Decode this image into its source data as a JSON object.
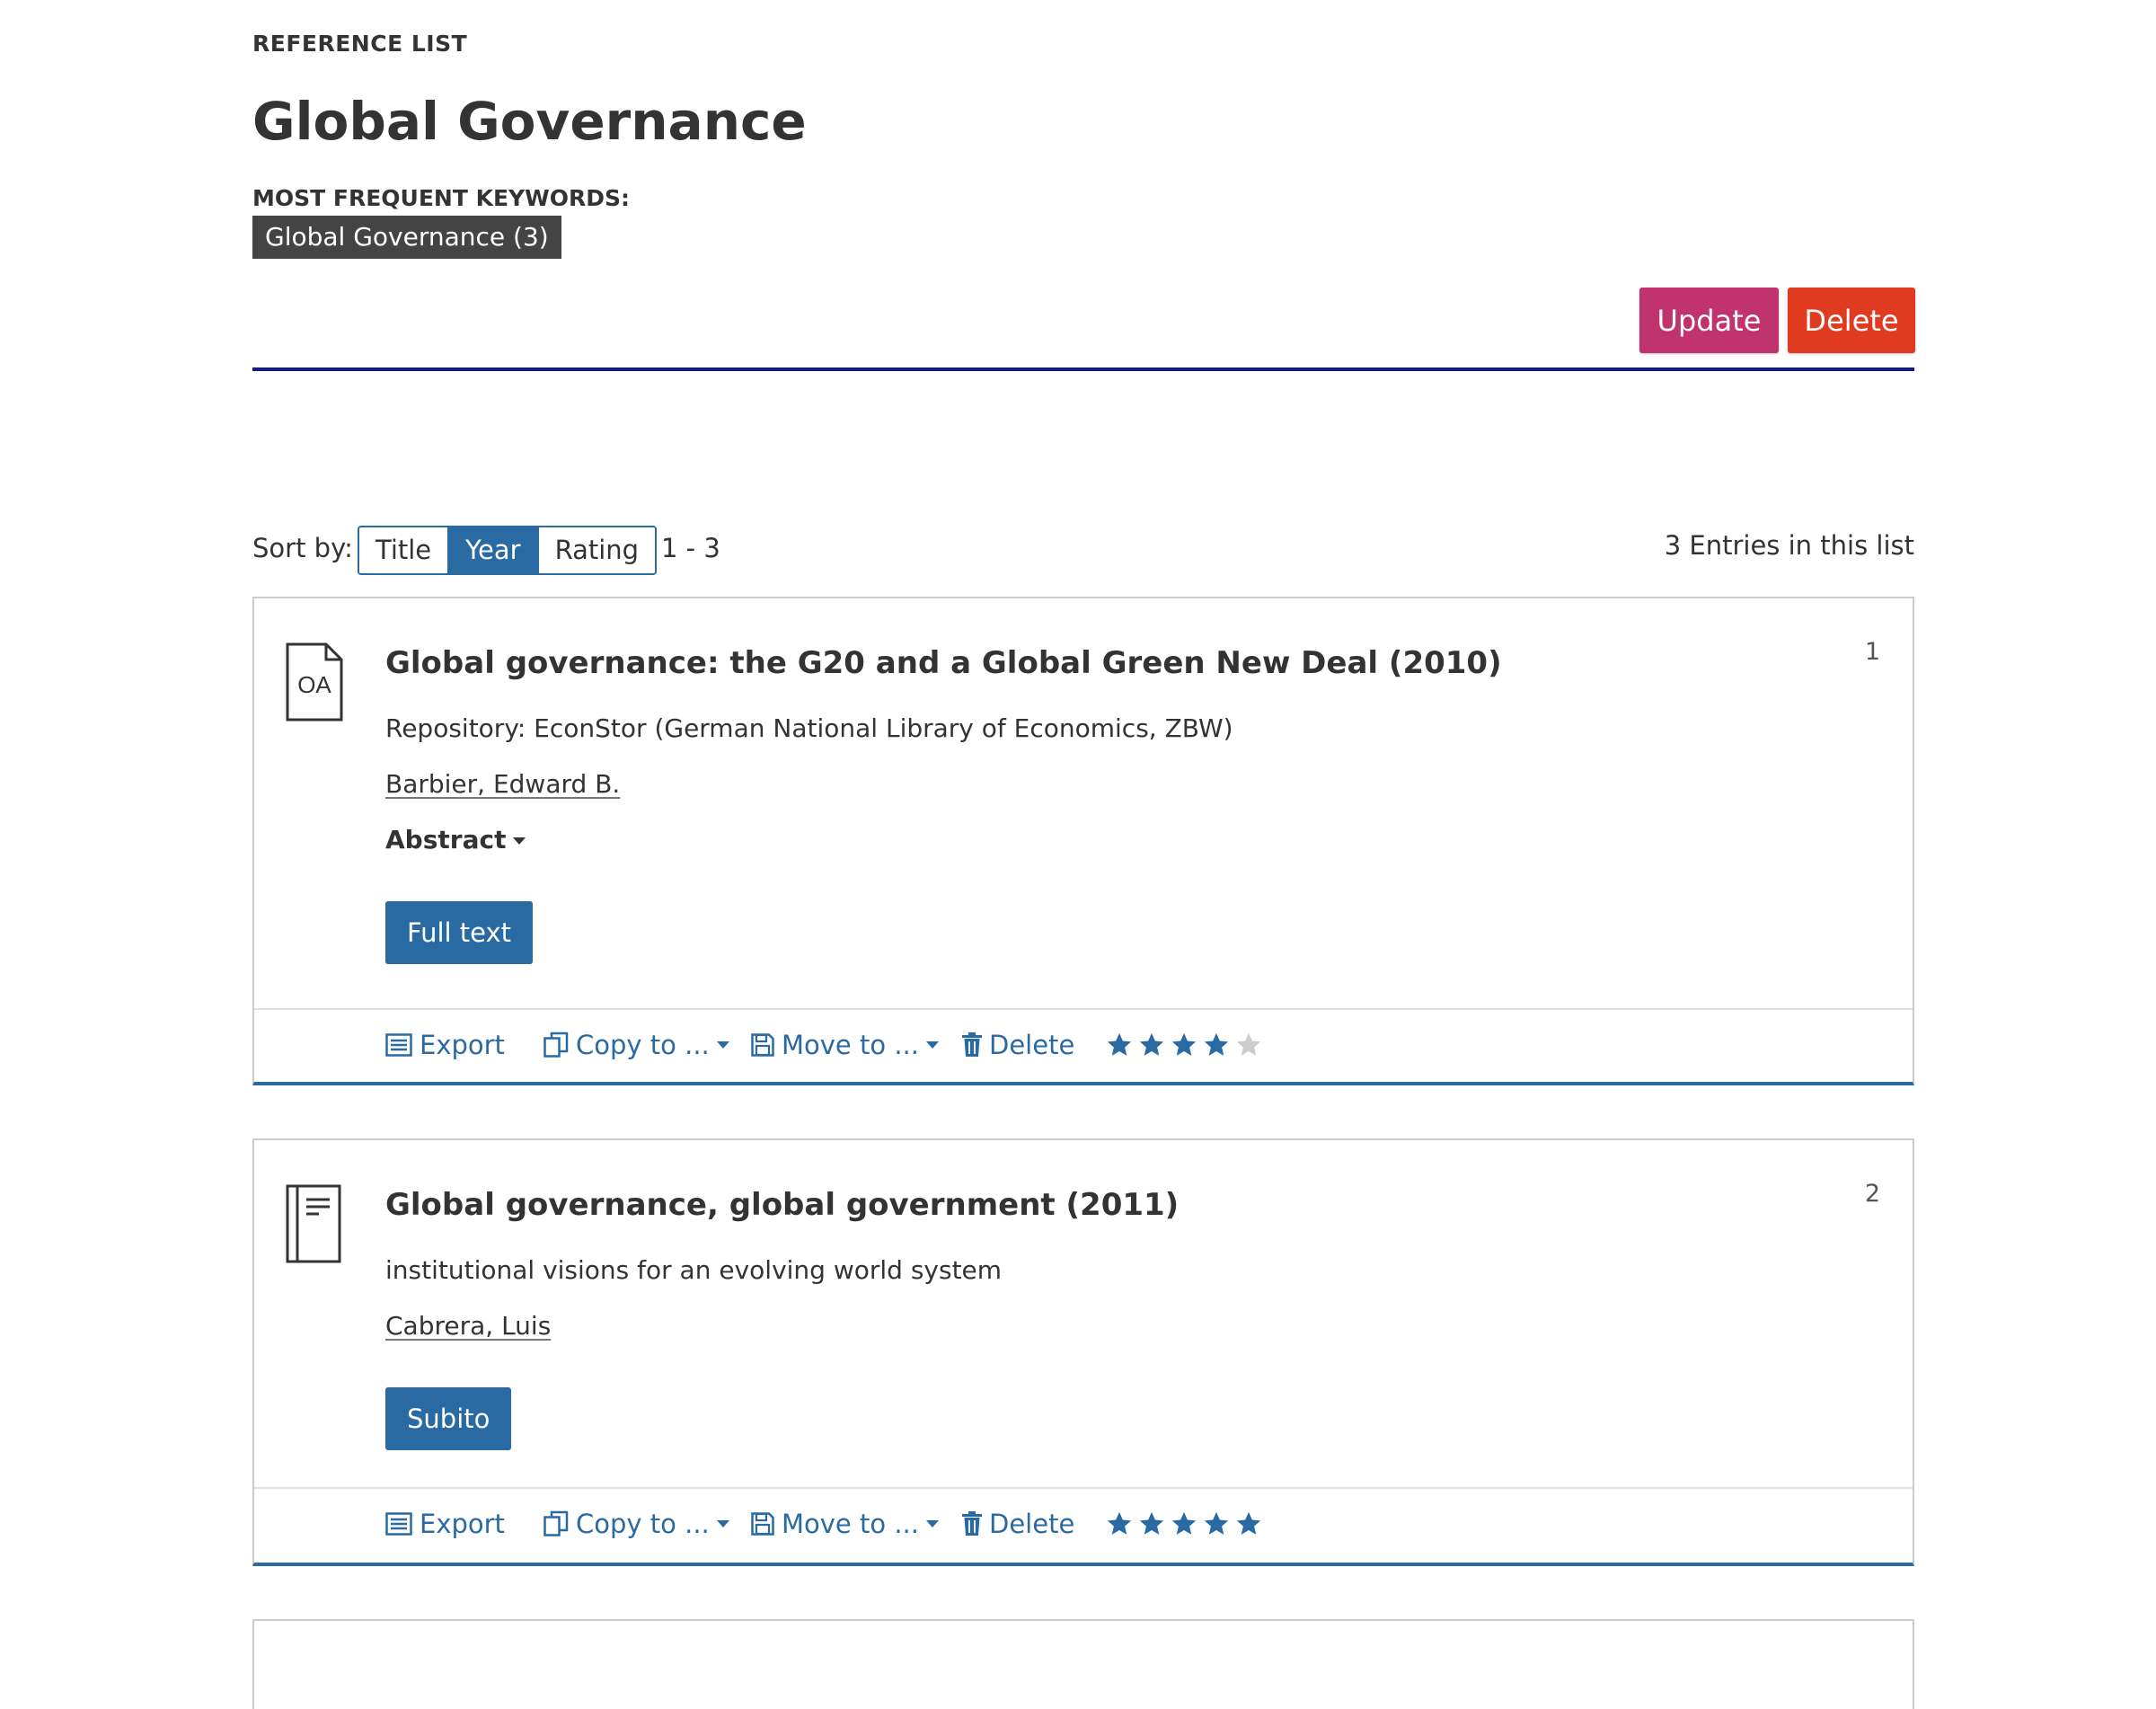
{
  "header": {
    "section_label": "REFERENCE LIST",
    "title": "Global Governance",
    "keywords_label": "MOST FREQUENT KEYWORDS:",
    "keywords": [
      "Global Governance (3)"
    ],
    "update_label": "Update",
    "delete_label": "Delete"
  },
  "colors": {
    "accent": "#2a6aa3",
    "update": "#c0336c",
    "delete": "#e03b20",
    "rule": "#0f1a8c",
    "star_on": "#2a6aa3",
    "star_off": "#cccccc"
  },
  "toolbar": {
    "sort_label": "Sort by:",
    "sort_options": [
      "Title",
      "Year",
      "Rating"
    ],
    "sort_selected": "Year",
    "range": "1 - 3",
    "entries_count": "3 Entries in this list"
  },
  "records": [
    {
      "number": "1",
      "icon": "open-access-document-icon",
      "icon_text": "OA",
      "title": "Global governance: the G20 and a Global Green New Deal (2010)",
      "subtitle": "Repository: EconStor (German National Library of Economics, ZBW)",
      "author": "Barbier, Edward B.",
      "abstract_label": "Abstract",
      "button_label": "Full text",
      "rating": 4,
      "rating_max": 5
    },
    {
      "number": "2",
      "icon": "book-icon",
      "title": "Global governance, global government (2011)",
      "subtitle": "institutional visions for an evolving world system",
      "author": "Cabrera, Luis",
      "button_label": "Subito",
      "rating": 5,
      "rating_max": 5
    }
  ],
  "actions": {
    "export_label": "Export",
    "copy_label": "Copy to ...",
    "move_label": "Move to ...",
    "delete_label": "Delete"
  }
}
